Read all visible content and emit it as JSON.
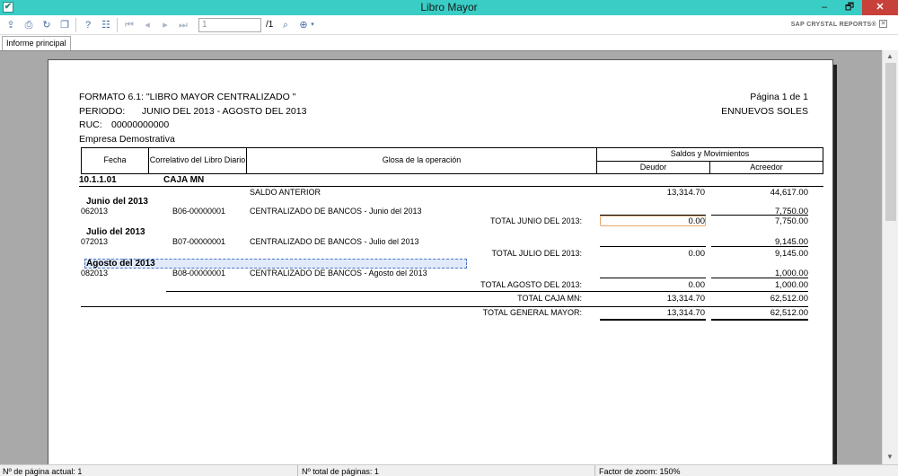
{
  "window": {
    "title": "Libro Mayor",
    "min": "–",
    "max": "🗗",
    "close": "✕"
  },
  "toolbar": {
    "page_input": "1",
    "page_total": "/1",
    "brand": "SAP CRYSTAL REPORTS®"
  },
  "tabs": {
    "main": "Informe principal"
  },
  "report": {
    "format": "FORMATO 6.1: \"LIBRO MAYOR CENTRALIZADO \"",
    "periodo_label": "PERIODO:",
    "periodo_value": "JUNIO DEL 2013 - AGOSTO DEL 2013",
    "ruc_label": "RUC:",
    "ruc_value": "00000000000",
    "empresa": "Empresa Demostrativa",
    "pagina": "Página 1 de 1",
    "moneda": "ENNUEVOS SOLES",
    "headers": {
      "fecha": "Fecha",
      "correlativo": "Correlativo del Libro Diario",
      "glosa": "Glosa de la operación",
      "saldos": "Saldos y Movimientos",
      "deudor": "Deudor",
      "acreedor": "Acreedor"
    },
    "cuenta_code": "10.1.1.01",
    "cuenta_name": "CAJA MN",
    "saldo_anterior": {
      "label": "SALDO ANTERIOR",
      "deudor": "13,314.70",
      "acreedor": "44,617.00"
    },
    "junio": {
      "title": "Junio del 2013",
      "fecha": "062013",
      "correlativo": "B06-00000001",
      "glosa": "CENTRALIZADO DE BANCOS - Junio del 2013",
      "acreedor": "7,750.00",
      "total_label": "TOTAL JUNIO DEL 2013:",
      "total_deudor": "0.00",
      "total_acreedor": "7,750.00"
    },
    "julio": {
      "title": "Julio del 2013",
      "fecha": "072013",
      "correlativo": "B07-00000001",
      "glosa": "CENTRALIZADO DE BANCOS - Julio del 2013",
      "acreedor": "9,145.00",
      "total_label": "TOTAL JULIO DEL 2013:",
      "total_deudor": "0.00",
      "total_acreedor": "9,145.00"
    },
    "agosto": {
      "title": "Agosto del 2013",
      "fecha": "082013",
      "correlativo": "B08-00000001",
      "glosa": "CENTRALIZADO DE BANCOS - Agosto del 2013",
      "acreedor": "1,000.00",
      "total_label": "TOTAL AGOSTO DEL 2013:",
      "total_deudor": "0.00",
      "total_acreedor": "1,000.00"
    },
    "total_caja": {
      "label": "TOTAL CAJA MN:",
      "deudor": "13,314.70",
      "acreedor": "62,512.00"
    },
    "total_general": {
      "label": "TOTAL GENERAL MAYOR:",
      "deudor": "13,314.70",
      "acreedor": "62,512.00"
    }
  },
  "status": {
    "pagina_actual": "Nº de página actual: 1",
    "total_paginas": "Nº total de páginas: 1",
    "zoom": "Factor de zoom: 150%"
  }
}
